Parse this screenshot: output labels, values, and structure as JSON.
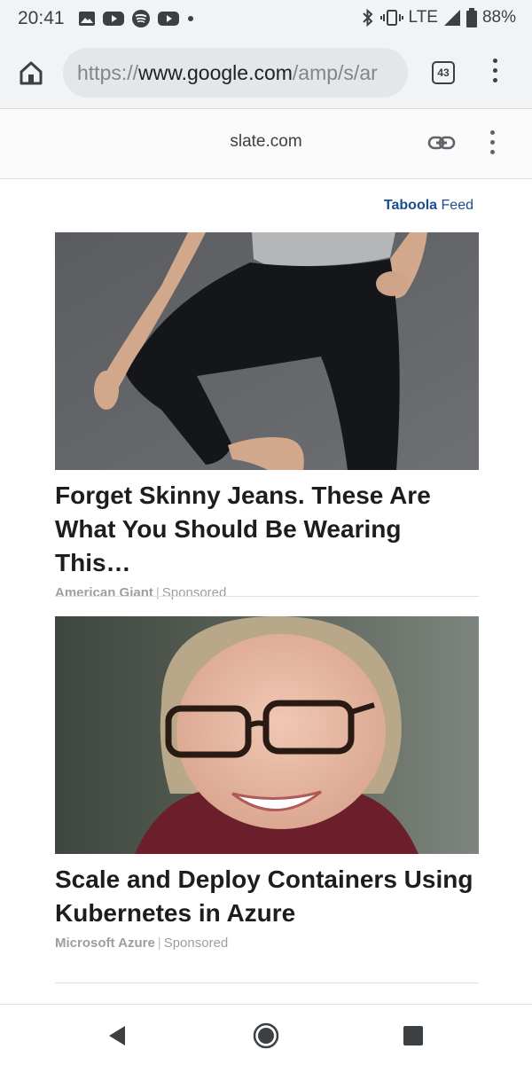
{
  "status_bar": {
    "time": "20:41",
    "network": "LTE",
    "battery": "88%",
    "notification_icons": [
      "photo-icon",
      "youtube-icon",
      "spotify-icon",
      "youtube-icon",
      "dot-icon"
    ]
  },
  "browser": {
    "url_scheme": "https://",
    "url_host": "www.google.com",
    "url_path": "/amp/s/ar",
    "tab_count": "43"
  },
  "amp_header": {
    "domain": "slate.com"
  },
  "feed": {
    "brand_main": "Taboola",
    "brand_suffix": "Feed",
    "items": [
      {
        "title": "Forget Skinny Jeans. These Are What You Should Be Wearing This…",
        "source": "American Giant",
        "sponsored": "Sponsored"
      },
      {
        "title": "Scale and Deploy Containers Using Kubernetes in Azure",
        "source": "Microsoft Azure",
        "sponsored": "Sponsored"
      }
    ]
  },
  "colors": {
    "chrome_bg": "#f1f3f4",
    "taboola_blue": "#1a4e8e",
    "title_text": "#1d1d1d",
    "meta_text": "#9e9e9e"
  }
}
